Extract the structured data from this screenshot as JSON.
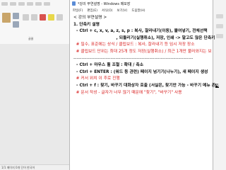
{
  "notepad": {
    "title": "*강의 부연설명 - Windows 메모장",
    "menu": [
      "파일(F)",
      "편집(E)",
      "서식(O)",
      "보기(V)",
      "도움말(H)"
    ],
    "lines": [
      {
        "text": "< 강의 부연설명 >",
        "style": "plain"
      },
      {
        "text": "",
        "style": "plain"
      },
      {
        "text": "1. 단축키 설명",
        "style": "bold"
      },
      {
        "text": "  - Ctrl + c, x, v, a, z, s, p : 복사, 잘라내기(이동), 붙여넣기, 전체선택",
        "style": "bold"
      },
      {
        "text": "                              , 되돌리기(실행취소), 저장, 인쇄 -> 말고도 많은 단축키",
        "style": "bold"
      },
      {
        "text": "  # 필수, 표준에는 상식 / 클립보드 : 복사, 잘라내기 등 임시 저장 장소",
        "style": "red"
      },
      {
        "text": "  # 클립보드 단위는 최대 25개 정도 저장(실행취소) / 최근 1개만 불러와지는 보",
        "style": "red"
      },
      {
        "text": "--------------------------------------------------------------------------",
        "style": "sep"
      },
      {
        "text": "  - Ctrl + 마우스 휠 조절 : 확대 / 축소",
        "style": "bold"
      },
      {
        "text": "  - Ctrl + ENTER : (워드 등 관련) 페이지 넘기기(나누기), 새 페이지 생성",
        "style": "bold"
      },
      {
        "text": "  # 커서 위치 이 후로 진행",
        "style": "red"
      },
      {
        "text": "  - Ctrl + f : 찾기, 바꾸기 대화상자 호출 (서실은, 찾기만 가능 - 바꾸기 메뉴 존",
        "style": "bold",
        "cursor_char": "재"
      },
      {
        "text": "  # 문서 작성 - 글자가 너무 많기 때문에 \"찾기\", \"바꾸기\" 사용",
        "style": "red"
      }
    ]
  },
  "background_app": {
    "status_text": "1/1 페이지  0개 단어  한국어",
    "ribbon_label": "글꼴"
  }
}
